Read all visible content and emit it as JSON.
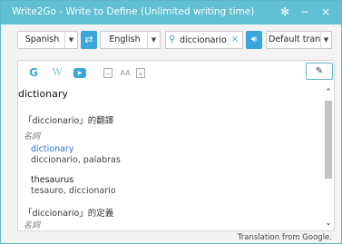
{
  "window": {
    "title": "Write2Go - Write to Define (Unlimited writing time)",
    "controls": {
      "settings_icon": "gear-icon",
      "minimize_glyph": "−",
      "close_glyph": "×"
    }
  },
  "toolbar": {
    "source_language": "Spanish",
    "target_language": "English",
    "swap_icon": "swap-icon",
    "search_value": "diccionario",
    "search_icon": "search-icon",
    "clear_glyph": "×",
    "speak_icon": "speaker-icon",
    "translator": "Default translat"
  },
  "tabs": {
    "google": "G",
    "wikipedia": "W",
    "youtube": "▶",
    "font_smaller": "−",
    "font_size_label": "AA",
    "font_larger": "+",
    "edit_icon": "pencil-icon"
  },
  "result": {
    "header": "dictionary",
    "translation_section": "「diccionario」的翻譯",
    "pos_label": "名詞",
    "entries": [
      {
        "word": "dictionary",
        "synonyms": "diccionario, palabras"
      },
      {
        "word": "thesaurus",
        "synonyms": "tesauro, diccionario"
      }
    ],
    "definition_section": "「diccionario」的定義",
    "definition_pos": "名詞"
  },
  "footer": {
    "attribution": "Translation from Google."
  },
  "colors": {
    "accent": "#3aa7dc",
    "titlebar": "#5fbfd3",
    "link": "#2f74c8"
  }
}
